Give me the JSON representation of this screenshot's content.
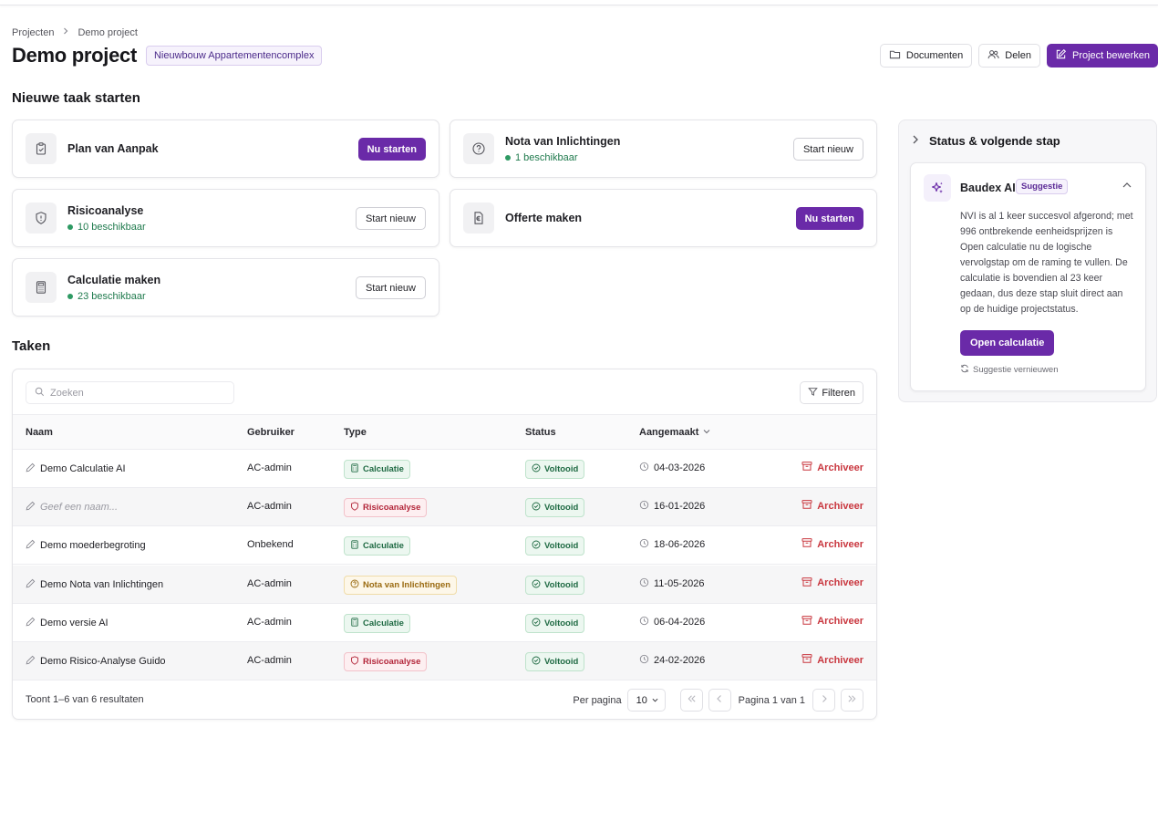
{
  "breadcrumb": [
    "Projecten",
    "Demo project"
  ],
  "page": {
    "title": "Demo project",
    "badge": "Nieuwbouw Appartementencomplex"
  },
  "header_actions": {
    "documents": "Documenten",
    "share": "Delen",
    "edit": "Project bewerken"
  },
  "new_task": {
    "title": "Nieuwe taak starten",
    "cards": [
      {
        "name": "Plan van Aanpak",
        "available": "",
        "cta": "Nu starten",
        "icon": "clipboard-icon"
      },
      {
        "name": "Nota van Inlichtingen",
        "available": "1 beschikbaar",
        "cta": "Start nieuw",
        "icon": "question-circle-icon"
      },
      {
        "name": "Risicoanalyse",
        "available": "10 beschikbaar",
        "cta": "Start nieuw",
        "icon": "shield-icon"
      },
      {
        "name": "Offerte maken",
        "available": "",
        "cta": "Nu starten",
        "icon": "euro-document-icon"
      },
      {
        "name": "Calculatie maken",
        "available": "23 beschikbaar",
        "cta": "Start nieuw",
        "icon": "calculator-icon"
      }
    ]
  },
  "status_panel": {
    "title": "Status & volgende stap",
    "ai_title": "Baudex AI",
    "ai_badge": "Suggestie",
    "ai_text": "NVI is al 1 keer succesvol afgerond; met 996 ontbrekende eenheidsprijzen is Open calculatie nu de logische vervolgstap om de raming te vullen. De calculatie is bovendien al 23 keer gedaan, dus deze stap sluit direct aan op de huidige projectstatus.",
    "ai_button": "Open calculatie",
    "refresh": "Suggestie vernieuwen"
  },
  "tasks": {
    "title": "Taken",
    "search_placeholder": "Zoeken",
    "filter": "Filteren",
    "columns": {
      "name": "Naam",
      "user": "Gebruiker",
      "type": "Type",
      "status": "Status",
      "created": "Aangemaakt"
    },
    "rows": [
      {
        "name": "Demo Calculatie AI",
        "placeholder": false,
        "user": "AC-admin",
        "type": "Calculatie",
        "type_kind": "calc",
        "status": "Voltooid",
        "created": "04-03-2026",
        "action": "Archiveer"
      },
      {
        "name": "Geef een naam...",
        "placeholder": true,
        "user": "AC-admin",
        "type": "Risicoanalyse",
        "type_kind": "risk",
        "status": "Voltooid",
        "created": "16-01-2026",
        "action": "Archiveer"
      },
      {
        "name": "Demo moederbegroting",
        "placeholder": false,
        "user": "Onbekend",
        "type": "Calculatie",
        "type_kind": "calc",
        "status": "Voltooid",
        "created": "18-06-2026",
        "action": "Archiveer"
      },
      {
        "name": "Demo Nota van Inlichtingen",
        "placeholder": false,
        "user": "AC-admin",
        "type": "Nota van Inlichtingen",
        "type_kind": "nvi",
        "status": "Voltooid",
        "created": "11-05-2026",
        "action": "Archiveer"
      },
      {
        "name": "Demo versie AI",
        "placeholder": false,
        "user": "AC-admin",
        "type": "Calculatie",
        "type_kind": "calc",
        "status": "Voltooid",
        "created": "06-04-2026",
        "action": "Archiveer"
      },
      {
        "name": "Demo Risico-Analyse Guido",
        "placeholder": false,
        "user": "AC-admin",
        "type": "Risicoanalyse",
        "type_kind": "risk",
        "status": "Voltooid",
        "created": "24-02-2026",
        "action": "Archiveer"
      }
    ],
    "footer": {
      "results": "Toont 1–6 van 6 resultaten",
      "per_page_label": "Per pagina",
      "per_page_value": "10",
      "page_label": "Pagina 1 van 1"
    }
  },
  "colors": {
    "brand": "#6a2aa8",
    "success": "#1f6a43",
    "danger": "#c9373f"
  }
}
